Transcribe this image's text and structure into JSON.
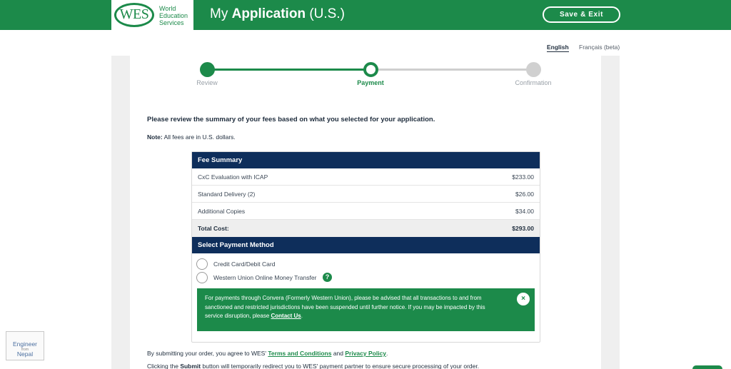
{
  "header": {
    "logo_mark": "WES",
    "logo_line1": "World",
    "logo_line2": "Education",
    "logo_line3": "Services",
    "title_prefix": "My ",
    "title_bold": "Application",
    "title_suffix": " (U.S.)",
    "save_exit_label": "Save & Exit"
  },
  "language": {
    "english": "English",
    "french": "Français (beta)",
    "selected": "English"
  },
  "stepper": {
    "steps": [
      {
        "label": "Review",
        "state": "complete"
      },
      {
        "label": "Payment",
        "state": "current"
      },
      {
        "label": "Confirmation",
        "state": "upcoming"
      }
    ]
  },
  "intro_text": "Please review the summary of your fees based on what you selected for your application.",
  "note": {
    "label": "Note:",
    "text": " All fees are in U.S. dollars."
  },
  "fee_summary": {
    "title": "Fee Summary",
    "rows": [
      {
        "name": "CxC Evaluation with ICAP",
        "amount": "$233.00"
      },
      {
        "name": "Standard Delivery (2)",
        "amount": "$26.00"
      },
      {
        "name": "Additional Copies",
        "amount": "$34.00"
      }
    ],
    "total_label": "Total Cost:",
    "total_amount": "$293.00"
  },
  "payment": {
    "title": "Select Payment Method",
    "options": [
      {
        "label": "Credit Card/Debit Card",
        "selected": false
      },
      {
        "label": "Western Union Online Money Transfer",
        "selected": false
      }
    ],
    "help_icon": "?",
    "alert_text": "For payments through Convera (Formerly Western Union), please be advised that all transactions to and from sanctioned and restricted jurisdictions have been suspended until further notice. If you may be impacted by this service disruption, please ",
    "alert_link": "Contact Us",
    "alert_end": ".",
    "alert_close": "×"
  },
  "footer": {
    "agree_prefix": "By submitting your order, you agree to WES' ",
    "terms_link": "Terms and Conditions",
    "agree_mid": " and ",
    "privacy_link": "Privacy Policy",
    "agree_end": ".",
    "redirect_prefix": "Clicking the ",
    "redirect_bold": "Submit",
    "redirect_suffix": " button will temporarily redirect you to WES' payment partner to ensure secure processing of your order."
  },
  "watermark": {
    "line1": "Engineer",
    "line2": "from",
    "line3": "Nepal"
  },
  "colors": {
    "brand_green": "#1c8a4a",
    "navy": "#0e2e5b",
    "gray_bg": "#efefef"
  }
}
